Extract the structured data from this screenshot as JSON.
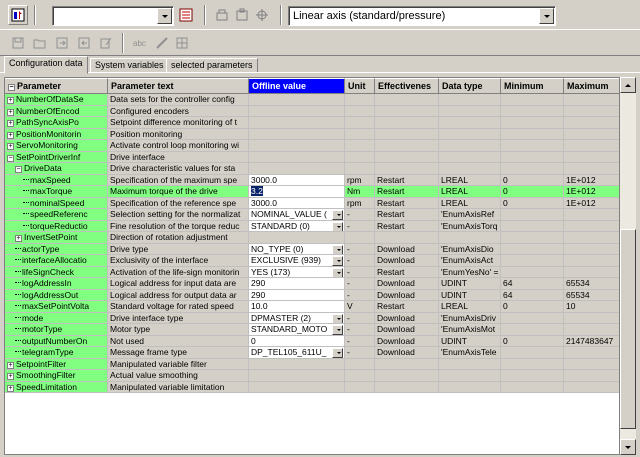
{
  "toolbar": {
    "combo_empty": "",
    "axis_type": "Linear axis (standard/pressure)",
    "buttons_row1": [
      "axis-icon",
      "combo-arrow",
      "properties-icon",
      "copy-icon",
      "paste-icon",
      "compare-icon"
    ],
    "buttons_row2": [
      "save-icon",
      "open-icon",
      "export-icon",
      "import-icon",
      "edit-icon",
      "abc-icon",
      "pen-icon",
      "grid-icon"
    ]
  },
  "tabs": [
    {
      "label": "Configuration data",
      "active": true
    },
    {
      "label": "System variables",
      "active": false
    },
    {
      "label": "selected parameters",
      "active": false
    }
  ],
  "columns": [
    {
      "label": "Parameter"
    },
    {
      "label": "Parameter text"
    },
    {
      "label": "Offline value"
    },
    {
      "label": "Unit"
    },
    {
      "label": "Effectivenes"
    },
    {
      "label": "Data type"
    },
    {
      "label": "Minimum"
    },
    {
      "label": "Maximum"
    }
  ],
  "rows": [
    {
      "name": "NumberOfDataSe",
      "indent": 1,
      "expander": "+",
      "text": "Data sets for the controller config",
      "value": "",
      "unit": "",
      "eff": "",
      "type": "",
      "min": "",
      "max": ""
    },
    {
      "name": "NumberOfEncod",
      "indent": 1,
      "expander": "+",
      "text": "Configured encoders",
      "value": "",
      "unit": "",
      "eff": "",
      "type": "",
      "min": "",
      "max": ""
    },
    {
      "name": "PathSyncAxisPo",
      "indent": 1,
      "expander": "+",
      "text": "Setpoint difference monitoring of t",
      "value": "",
      "unit": "",
      "eff": "",
      "type": "",
      "min": "",
      "max": ""
    },
    {
      "name": "PositionMonitorin",
      "indent": 1,
      "expander": "+",
      "text": "Position monitoring",
      "value": "",
      "unit": "",
      "eff": "",
      "type": "",
      "min": "",
      "max": ""
    },
    {
      "name": "ServoMonitoring",
      "indent": 1,
      "expander": "+",
      "text": "Activate control loop monitoring wi",
      "value": "",
      "unit": "",
      "eff": "",
      "type": "",
      "min": "",
      "max": ""
    },
    {
      "name": "SetPointDriverInf",
      "indent": 1,
      "expander": "-",
      "text": "Drive interface",
      "value": "",
      "unit": "",
      "eff": "",
      "type": "",
      "min": "",
      "max": ""
    },
    {
      "name": "DriveData",
      "indent": 2,
      "expander": "-",
      "text": "Drive characteristic values for sta",
      "value": "",
      "unit": "",
      "eff": "",
      "type": "",
      "min": "",
      "max": ""
    },
    {
      "name": "maxSpeed",
      "indent": 3,
      "expander": "",
      "text": "Specification of the maximum spe",
      "value": "3000.0",
      "unit": "rpm",
      "eff": "Restart",
      "type": "LREAL",
      "min": "0",
      "max": "1E+012"
    },
    {
      "name": "maxTorque",
      "indent": 3,
      "expander": "",
      "text": "Maximum torque of the drive",
      "value": "3.2",
      "unit": "Nm",
      "eff": "Restart",
      "type": "LREAL",
      "min": "0",
      "max": "1E+012",
      "highlight": true
    },
    {
      "name": "nominalSpeed",
      "indent": 3,
      "expander": "",
      "text": "Specification of the reference spe",
      "value": "3000.0",
      "unit": "rpm",
      "eff": "Restart",
      "type": "LREAL",
      "min": "0",
      "max": "1E+012"
    },
    {
      "name": "speedReferenc",
      "indent": 3,
      "expander": "",
      "text": "Selection setting for the normalizat",
      "value": "NOMINAL_VALUE (",
      "unit": "-",
      "eff": "Restart",
      "type": "'EnumAxisRef",
      "min": "",
      "max": "",
      "combo": true
    },
    {
      "name": "torqueReductio",
      "indent": 3,
      "expander": "",
      "text": "Fine resolution of the torque reduc",
      "value": "STANDARD (0)",
      "unit": "-",
      "eff": "Restart",
      "type": "'EnumAxisTorq",
      "min": "",
      "max": "",
      "combo": true
    },
    {
      "name": "InvertSetPoint",
      "indent": 2,
      "expander": "+",
      "text": "Direction of rotation adjustment",
      "value": "",
      "unit": "",
      "eff": "",
      "type": "",
      "min": "",
      "max": ""
    },
    {
      "name": "actorType",
      "indent": 2,
      "expander": "",
      "text": "Drive type",
      "value": "NO_TYPE (0)",
      "unit": "-",
      "eff": "Download",
      "type": "'EnumAxisDio",
      "min": "",
      "max": "",
      "combo": true
    },
    {
      "name": "interfaceAllocatio",
      "indent": 2,
      "expander": "",
      "text": "Exclusivity of the interface",
      "value": "EXCLUSIVE (939)",
      "unit": "-",
      "eff": "Download",
      "type": "'EnumAxisAct",
      "min": "",
      "max": "",
      "combo": true
    },
    {
      "name": "lifeSignCheck",
      "indent": 2,
      "expander": "",
      "text": "Activation of the life-sign monitorin",
      "value": "YES (173)",
      "unit": "-",
      "eff": "Restart",
      "type": "'EnumYesNo' =",
      "min": "",
      "max": "",
      "combo": true
    },
    {
      "name": "logAddressIn",
      "indent": 2,
      "expander": "",
      "text": "Logical address for input data are",
      "value": "290",
      "unit": "-",
      "eff": "Download",
      "type": "UDINT",
      "min": "64",
      "max": "65534"
    },
    {
      "name": "logAddressOut",
      "indent": 2,
      "expander": "",
      "text": "Logical address for output data ar",
      "value": "290",
      "unit": "-",
      "eff": "Download",
      "type": "UDINT",
      "min": "64",
      "max": "65534"
    },
    {
      "name": "maxSetPointVolta",
      "indent": 2,
      "expander": "",
      "text": "Standard voltage for rated speed",
      "value": "10.0",
      "unit": "V",
      "eff": "Restart",
      "type": "LREAL",
      "min": "0",
      "max": "10"
    },
    {
      "name": "mode",
      "indent": 2,
      "expander": "",
      "text": "Drive interface type",
      "value": "DPMASTER (2)",
      "unit": "-",
      "eff": "Download",
      "type": "'EnumAxisDriv",
      "min": "",
      "max": "",
      "combo": true
    },
    {
      "name": "motorType",
      "indent": 2,
      "expander": "",
      "text": "Motor type",
      "value": "STANDARD_MOTO",
      "unit": "-",
      "eff": "Download",
      "type": "'EnumAxisMot",
      "min": "",
      "max": "",
      "combo": true
    },
    {
      "name": "outputNumberOn",
      "indent": 2,
      "expander": "",
      "text": "Not used",
      "value": "0",
      "unit": "-",
      "eff": "Download",
      "type": "UDINT",
      "min": "0",
      "max": "2147483647"
    },
    {
      "name": "telegramType",
      "indent": 2,
      "expander": "",
      "text": "Message frame type",
      "value": "DP_TEL105_611U_",
      "unit": "-",
      "eff": "Download",
      "type": "'EnumAxisTele",
      "min": "",
      "max": "",
      "combo": true
    },
    {
      "name": "SetpointFilter",
      "indent": 1,
      "expander": "+",
      "text": "Manipulated variable filter",
      "value": "",
      "unit": "",
      "eff": "",
      "type": "",
      "min": "",
      "max": ""
    },
    {
      "name": "SmoothingFilter",
      "indent": 1,
      "expander": "+",
      "text": "Actual value smoothing",
      "value": "",
      "unit": "",
      "eff": "",
      "type": "",
      "min": "",
      "max": ""
    },
    {
      "name": "SpeedLimitation",
      "indent": 1,
      "expander": "+",
      "text": "Manipulated variable limitation",
      "value": "",
      "unit": "",
      "eff": "",
      "type": "",
      "min": "",
      "max": ""
    }
  ],
  "colors": {
    "green": "#80ff80",
    "header_selected": "#0000ff",
    "face": "#d4d0c8"
  }
}
